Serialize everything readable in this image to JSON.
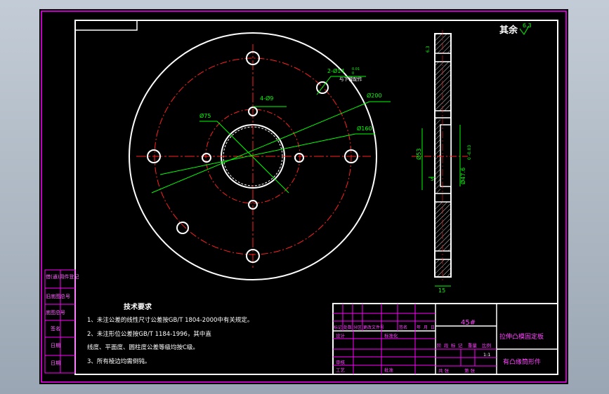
{
  "colors": {
    "background": "#000000",
    "border": "#ff00ff",
    "outline": "#ffffff",
    "centerline": "#ff2020",
    "dimension": "#00ff00",
    "hatch": "#ffffff",
    "title_accent": "#ff00ff",
    "outer_bg": "#a9b3bf"
  },
  "roughness": {
    "label": "其余",
    "value": "6.3"
  },
  "front_view": {
    "dims": {
      "bolt_holes": "2-Ø14",
      "bolt_tol_upper": "0.01",
      "bolt_tol_lower": "0",
      "bolt_note": "与下模配作",
      "small_holes": "4-Ø9",
      "outer_diameter": "Ø200",
      "pitch_diameter": "Ø160",
      "inner_circle": "Ø75"
    }
  },
  "side_view": {
    "dims": {
      "roughness_top": "6.3",
      "boss_diameter": "Ø53",
      "bore_diameter": "Ø47.6",
      "bore_tol": "0 -0.03",
      "step_depth": "5",
      "width": "15"
    }
  },
  "tech_requirements": {
    "title": "技术要求",
    "items": [
      "1、未注公差的线性尺寸公差按GB/T 1804-2000中有关规定。",
      "2、未注形位公差按GB/T 1184-1996，其中直",
      "   线度、平面度、圆柱度公差等级均按C级。",
      "3、所有棱边均需倒钝。"
    ]
  },
  "side_labels": [
    "借(通)用件登记",
    "旧底图总号",
    "底图总号",
    "签名",
    "日期",
    "日期"
  ],
  "title_block": {
    "material": "45#",
    "part_name": "拉伸凸模固定板",
    "drawing_title": "有凸缘筒形件",
    "header_row": [
      "标记",
      "处数",
      "分区",
      "更改文件号",
      "签名",
      "年",
      "月",
      "日"
    ],
    "roles": [
      "设计",
      "审核",
      "工艺"
    ],
    "roles_mid": [
      "标准化",
      "批准"
    ],
    "stage_labels": [
      "阶",
      "段",
      "标",
      "记",
      "重量",
      "比例"
    ],
    "scale": "1:1",
    "sheets": "共 张",
    "sheet_no": "第 张"
  }
}
